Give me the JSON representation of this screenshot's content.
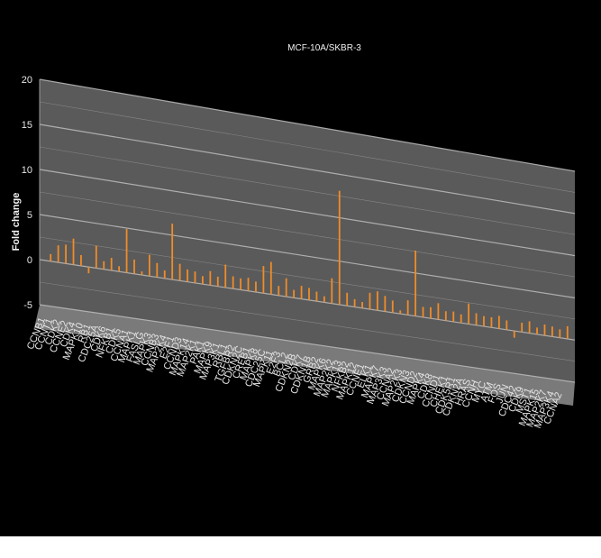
{
  "chart_data": {
    "type": "bar",
    "title": "MCF-10A/SKBR-3",
    "ylabel": "Fold change",
    "xlabel": "",
    "ylim": [
      -5,
      20
    ],
    "yticks": [
      -5,
      0,
      5,
      10,
      15,
      20
    ],
    "grid": true,
    "colors": {
      "background": "#000000",
      "wall": "#5a5a5a",
      "floor": "#7a7a7a",
      "bar": "#f08c28",
      "grid": "#bdbdbd"
    },
    "categories": [
      "CCNB1",
      "CCNT1",
      "CDK2",
      "CCNE2",
      "CDK4",
      "MAPK10",
      "RB1",
      "CDC25A",
      "CDK6",
      "NFKB1",
      "CDK5",
      "CCNA1",
      "MAPK1",
      "FASLG",
      "MAPK3",
      "CCNB3",
      "MAP2K4",
      "E2F1",
      "CCND3",
      "MAPK14",
      "MAP2K1",
      "PAK1",
      "MAPK9",
      "MAP3K1",
      "RBL1",
      "TGFBR2",
      "CDKN2C",
      "CREB1",
      "MAPK8",
      "CDC25C",
      "MAPK11",
      "E2F3",
      "BCL2",
      "CDKN2B",
      "CDK7",
      "CDKN1B",
      "GRB2",
      "MAPK6",
      "MAP2K2",
      "MAPK13",
      "NFKB2",
      "MAPK12",
      "CCNE1",
      "ELK1",
      "MAPK7",
      "MAP3K3",
      "CCNA2",
      "MAP2K3",
      "CDKN3",
      "CCND2",
      "MAPK4",
      "CDK8",
      "CCND1",
      "CHEK1",
      "CDK5R1",
      "CDKN2A",
      "HRAS",
      "CCNH",
      "MYC",
      "ATM",
      "FOS",
      "JUN",
      "CDC42",
      "CDK9",
      "MST1",
      "MAPK15",
      "MAP2K7",
      "MAP3K4",
      "CCNA2"
    ],
    "series": [
      {
        "values": [
          0.8,
          1.9,
          2.1,
          2.9,
          1.2,
          -0.7,
          2.5,
          0.9,
          1.4,
          0.6,
          4.9,
          1.6,
          0.4,
          2.4,
          1.6,
          0.9,
          6.3,
          1.9,
          1.4,
          1.3,
          0.9,
          1.6,
          1.1,
          2.6,
          1.4,
          1.3,
          1.5,
          1.2,
          3.1,
          3.7,
          1.1,
          2.1,
          0.9,
          1.5,
          1.4,
          1.1,
          0.7,
          2.9,
          13.1,
          1.5,
          0.9,
          0.7,
          1.9,
          2.2,
          1.8,
          1.4,
          0.4,
          1.7,
          7.6,
          1.2,
          1.3,
          1.9,
          1.1,
          1.2,
          1.0,
          2.4,
          1.4,
          1.2,
          1.2,
          1.5,
          1.1,
          -0.8,
          1.1,
          1.4,
          0.8,
          1.3,
          1.2,
          1.0,
          1.5,
          1.2
        ]
      }
    ]
  }
}
